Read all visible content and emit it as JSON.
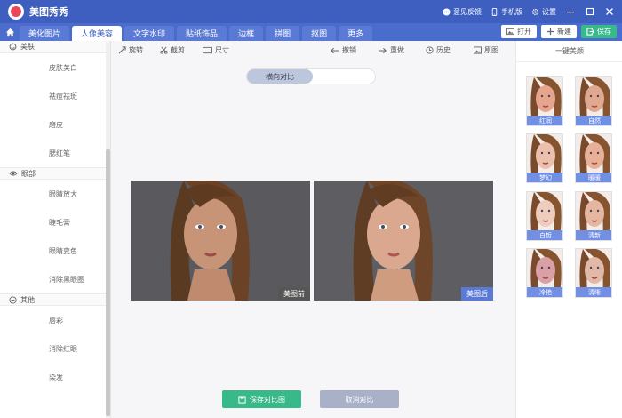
{
  "app": {
    "title": "美图秀秀"
  },
  "titlebar": {
    "feedback": "意见反馈",
    "mobile": "手机版",
    "settings": "设置"
  },
  "tabs": [
    {
      "label": "美化图片"
    },
    {
      "label": "人像美容"
    },
    {
      "label": "文字水印"
    },
    {
      "label": "贴纸饰品"
    },
    {
      "label": "边框"
    },
    {
      "label": "拼图"
    },
    {
      "label": "抠图"
    },
    {
      "label": "更多"
    }
  ],
  "actions": {
    "open": "打开",
    "new": "新建",
    "save": "保存"
  },
  "sidebar": {
    "cat_skin": "美肤",
    "skin_items": [
      "皮肤美白",
      "祛痘祛斑",
      "磨皮",
      "腮红笔"
    ],
    "cat_eye": "眼部",
    "eye_items": [
      "眼睛放大",
      "睫毛膏",
      "眼睛变色",
      "消除黑眼圈"
    ],
    "cat_other": "其他",
    "other_items": [
      "唇彩",
      "消除红眼",
      "染发"
    ]
  },
  "toolbar": {
    "rotate": "旋转",
    "crop": "截剪",
    "size": "尺寸",
    "undo": "撤销",
    "redo": "重做",
    "history": "历史",
    "original": "原图"
  },
  "compare": {
    "toggle_label": "横向对比",
    "before_label": "美图前",
    "after_label": "美图后",
    "save_button": "保存对比图",
    "cancel_button": "取消对比"
  },
  "presets": {
    "title": "一键美颜",
    "items": [
      "红润",
      "自然",
      "梦幻",
      "暖暖",
      "白皙",
      "清新",
      "冷艳",
      "清晰"
    ]
  },
  "colors": {
    "brand_blue": "#3e5fbf",
    "accent_green": "#38b98a",
    "label_blue": "#5b7ad5"
  }
}
